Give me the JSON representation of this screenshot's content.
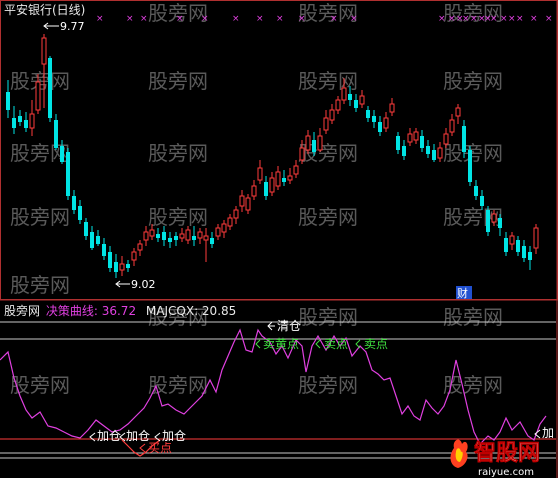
{
  "main_panel": {
    "title": "平安银行(日线)",
    "high_marker": "9.77",
    "low_marker": "9.02",
    "cai_label": "财"
  },
  "indicator_panel": {
    "legend_name": "股旁网",
    "juece_label": "决策曲线",
    "juece_value": "36.72",
    "majcqx_label": "MAJCQX",
    "majcqx_value": "20.85",
    "signals": {
      "qingcang": "清仓",
      "maihuangdian": "卖黄点",
      "maidian_1": "卖点",
      "maidian_2": "卖点",
      "jiacang_1": "加仓",
      "jiacang_2": "加仓",
      "jiacang_3": "加仓",
      "jiacang_4": "加",
      "maidian_red": "买点"
    }
  },
  "watermarks": [
    "股旁网",
    "股旁网",
    "股旁网",
    "股旁网",
    "股旁网",
    "股旁网",
    "股旁网",
    "股旁网",
    "股旁网",
    "股旁网",
    "股旁网",
    "股旁网",
    "股旁网",
    "股旁网",
    "股旁网",
    "股旁网"
  ],
  "logo": {
    "main": "智股网",
    "sub": "raiyue.com"
  },
  "colors": {
    "up_candle": "#ff3c3c",
    "down_candle": "#00e5e5",
    "indicator_line": "#e040e0",
    "buy_line": "#ff3c3c",
    "frame": "#b03030",
    "title": "#e8e8e8",
    "magenta_label": "#e040e0",
    "white_label": "#ffffff",
    "green_label": "#40e040"
  }
}
